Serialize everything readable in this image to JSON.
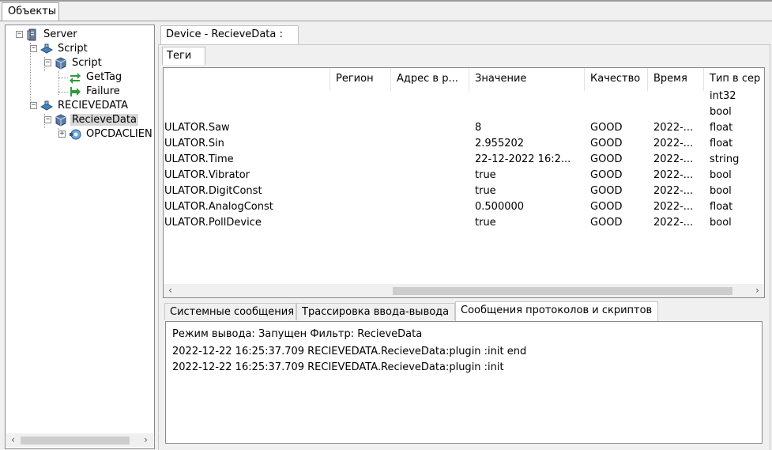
{
  "main_tab": "Объекты",
  "tree": {
    "nodes": [
      {
        "label": "Server"
      },
      {
        "label": "Script"
      },
      {
        "label": "Script"
      },
      {
        "label": "GetTag"
      },
      {
        "label": "Failure"
      },
      {
        "label": "RECIEVEDATA"
      },
      {
        "label": "RecieveData"
      },
      {
        "label": "OPCDACLIEN"
      }
    ]
  },
  "device_title": "Device - RecieveData :",
  "tags_tab": "Теги",
  "table": {
    "columns": [
      "",
      "Регион",
      "Адрес в р...",
      "Значение",
      "Качество",
      "Время",
      "Тип в сер"
    ],
    "rows": [
      [
        "",
        "",
        "",
        "",
        "",
        "",
        "int32"
      ],
      [
        "",
        "",
        "",
        "",
        "",
        "",
        "bool"
      ],
      [
        "ULATOR.Saw",
        "",
        "",
        "8",
        "GOOD",
        "2022-...",
        "float"
      ],
      [
        "ULATOR.Sin",
        "",
        "",
        "2.955202",
        "GOOD",
        "2022-...",
        "float"
      ],
      [
        "ULATOR.Time",
        "",
        "",
        "22-12-2022 16:2...",
        "GOOD",
        "2022-...",
        "string"
      ],
      [
        "ULATOR.Vibrator",
        "",
        "",
        "true",
        "GOOD",
        "2022-...",
        "bool"
      ],
      [
        "ULATOR.DigitConst",
        "",
        "",
        "true",
        "GOOD",
        "2022-...",
        "bool"
      ],
      [
        "ULATOR.AnalogConst",
        "",
        "",
        "0.500000",
        "GOOD",
        "2022-...",
        "float"
      ],
      [
        "ULATOR.PollDevice",
        "",
        "",
        "true",
        "GOOD",
        "2022-...",
        "bool"
      ]
    ]
  },
  "bottom_tabs": [
    {
      "label": "Системные сообщения"
    },
    {
      "label": "Трассировка ввода-вывода"
    },
    {
      "label": "Сообщения протоколов и скриптов"
    }
  ],
  "log": {
    "header": "Режим вывода: Запущен Фильтр: RecieveData",
    "lines": [
      "2022-12-22 16:25:37.709 RECIEVEDATA.RecieveData:plugin :init end",
      "2022-12-22 16:25:37.709 RECIEVEDATA.RecieveData:plugin :init"
    ]
  },
  "scroll_arrows": {
    "left": "‹",
    "right": "›"
  },
  "expander_symbols": {
    "minus": "−",
    "plus": "+"
  },
  "colors": {
    "selection": "#d8d8d8",
    "border": "#8a8a8a"
  }
}
